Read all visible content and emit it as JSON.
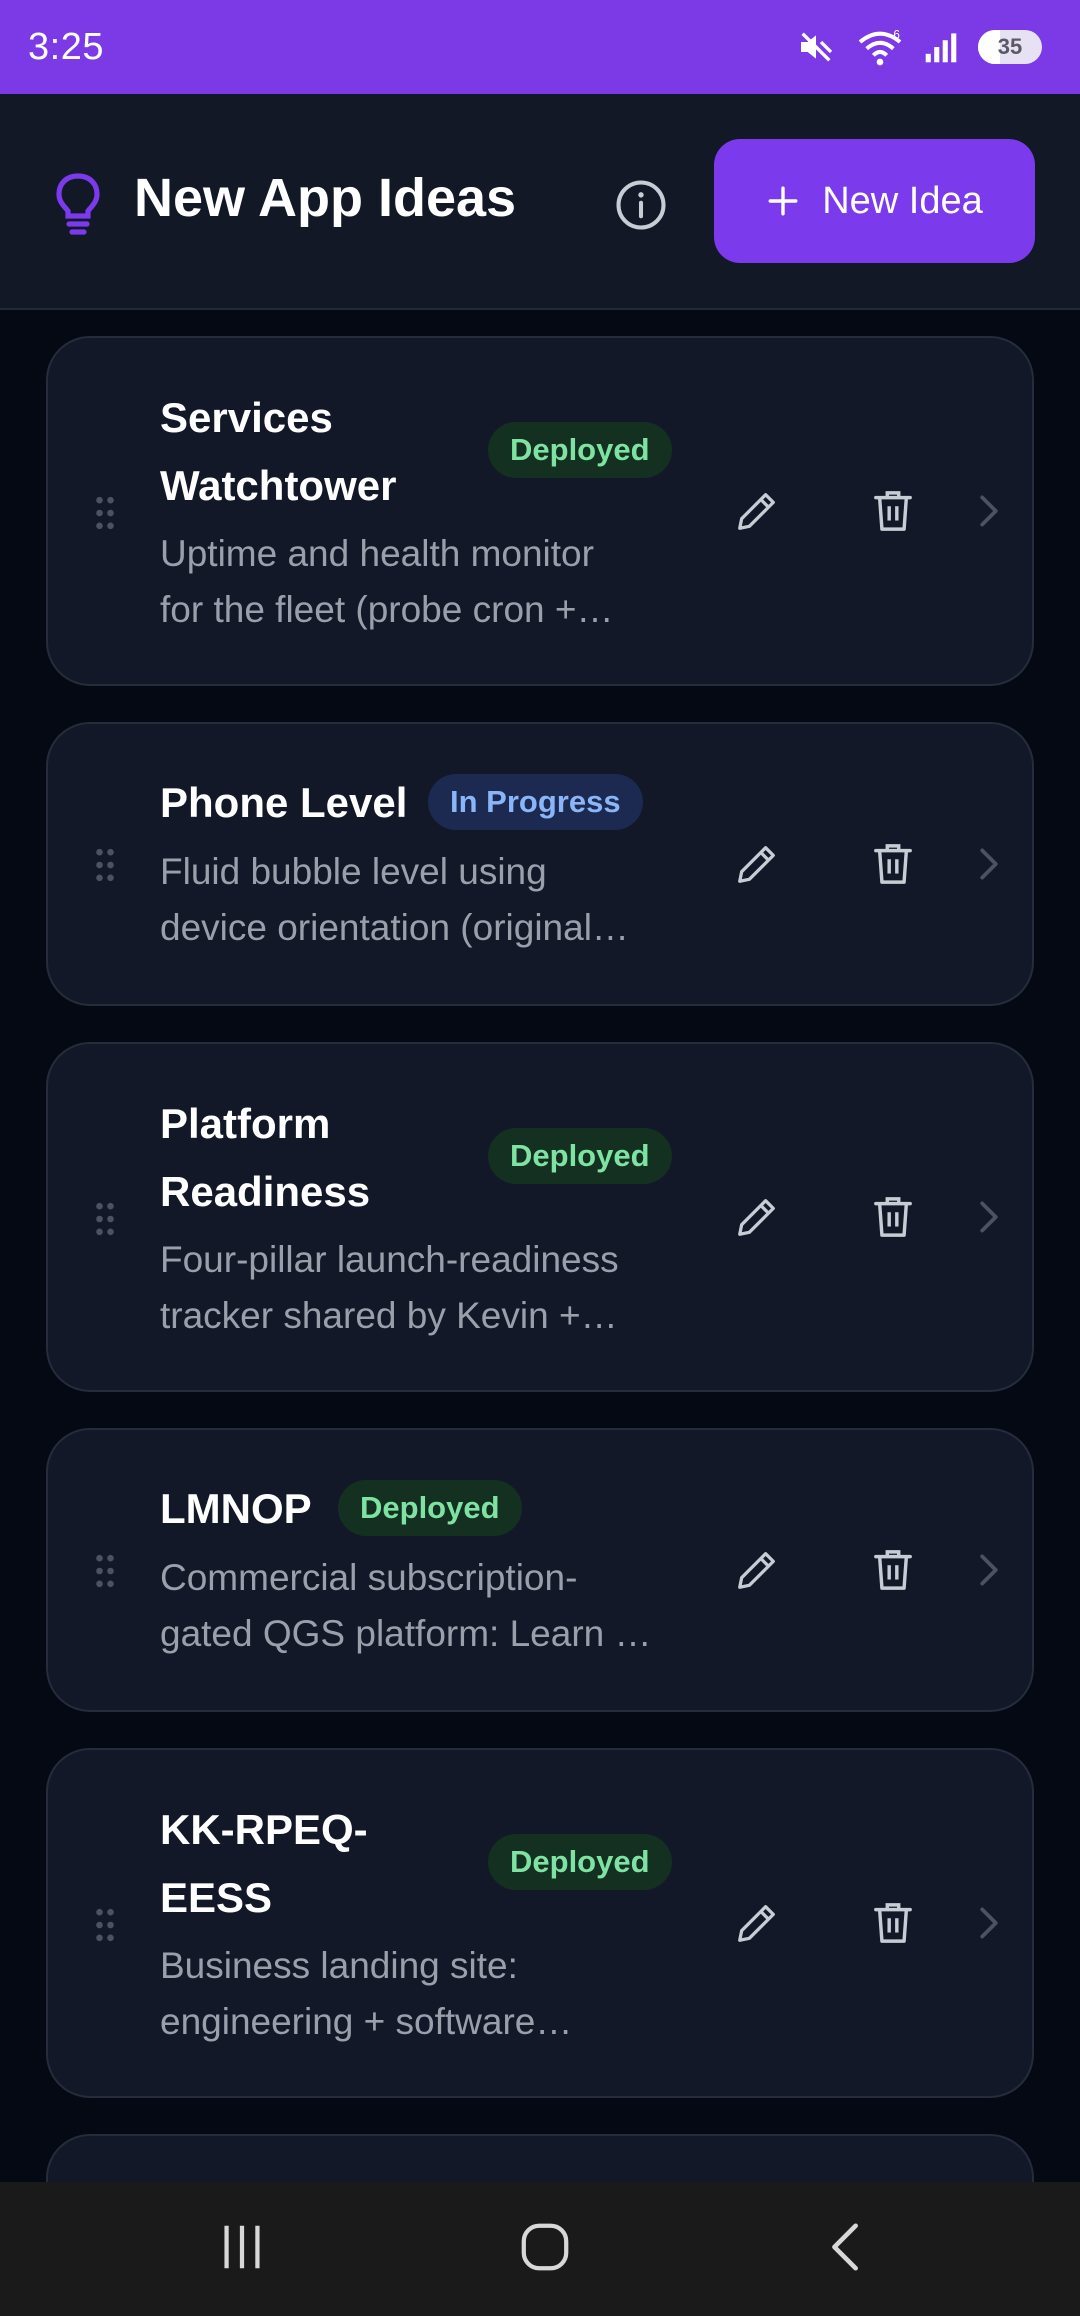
{
  "status": {
    "time": "3:25",
    "battery": "35"
  },
  "header": {
    "title": "New App Ideas",
    "new_button_label": "New Idea"
  },
  "ideas": [
    {
      "title_line1": "Services",
      "title_line2": "Watchtower",
      "status": "Deployed",
      "desc": "Uptime and health monitor\nfor the fleet (probe cron +…"
    },
    {
      "title_line1": "Phone Level",
      "title_line2": "",
      "status": "In Progress",
      "desc": "Fluid bubble level using\ndevice orientation (original…"
    },
    {
      "title_line1": "Platform",
      "title_line2": "Readiness",
      "status": "Deployed",
      "desc": "Four-pillar launch-readiness\ntracker shared by Kevin +…"
    },
    {
      "title_line1": "LMNOP",
      "title_line2": "",
      "status": "Deployed",
      "desc": "Commercial subscription-\ngated QGS platform: Learn …"
    },
    {
      "title_line1": "KK-RPEQ-",
      "title_line2": "EESS",
      "status": "Deployed",
      "desc": "Business landing site:\nengineering + software…"
    }
  ],
  "colors": {
    "accent": "#7c3aed",
    "status_bar": "#7b3ae6",
    "card_bg": "#121827",
    "deployed_text": "#7ee2a2",
    "in_progress_text": "#8ab6f8"
  },
  "icons": [
    "mute-icon",
    "wifi-icon",
    "signal-icon",
    "battery-icon",
    "lightbulb-icon",
    "info-icon",
    "plus-icon",
    "drag-handle-icon",
    "pencil-icon",
    "trash-icon",
    "chevron-right-icon",
    "recents-icon",
    "home-icon",
    "back-icon"
  ]
}
